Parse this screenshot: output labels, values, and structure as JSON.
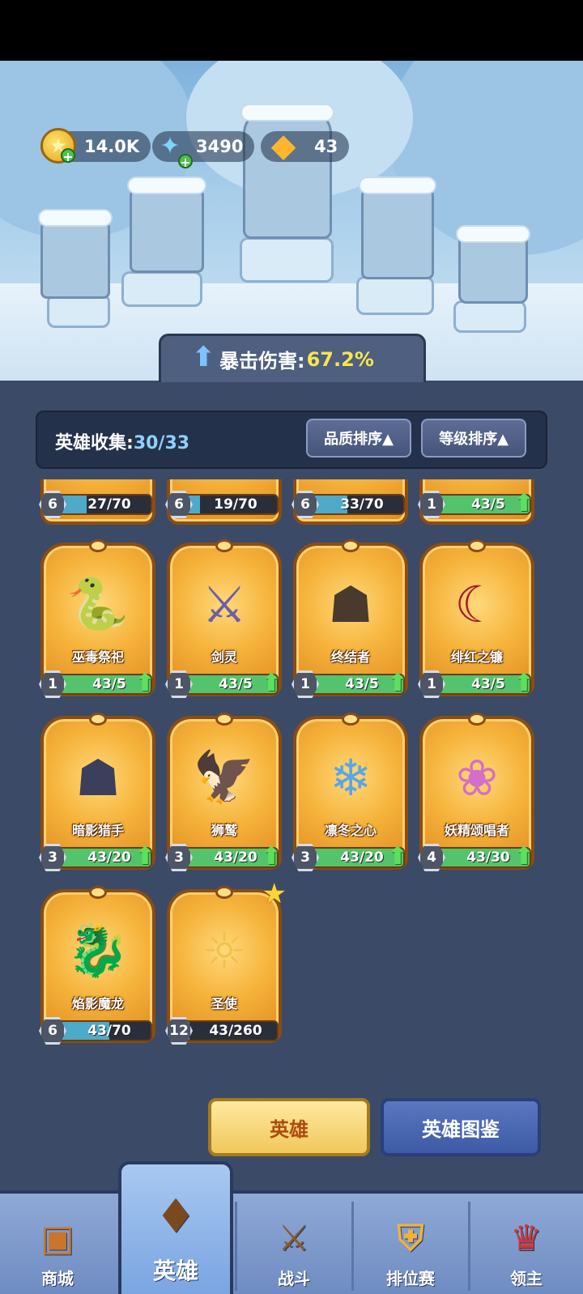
{
  "resources": [
    {
      "name": "gold",
      "icon": "gold-coin-icon",
      "value": "14.0K"
    },
    {
      "name": "crystal",
      "icon": "blue-crystal-icon",
      "value": "3490"
    },
    {
      "name": "gem",
      "icon": "orange-crystal-icon",
      "value": "43"
    }
  ],
  "buff": {
    "label": "暴击伤害:",
    "value": "67.2%"
  },
  "collection": {
    "label": "英雄收集:",
    "count": "30/33",
    "sort_quality": "品质排序▲",
    "sort_level": "等级排序▲"
  },
  "partial_cards": [
    {
      "level": "6",
      "progress": "27/70"
    },
    {
      "level": "6",
      "progress": "19/70"
    },
    {
      "level": "6",
      "progress": "33/70"
    },
    {
      "level": "1",
      "progress": "43/5"
    }
  ],
  "cards": [
    {
      "name": "巫毒祭祀",
      "level": "1",
      "progress": "43/5",
      "fill": 1.0,
      "upgrade": true
    },
    {
      "name": "剑灵",
      "level": "1",
      "progress": "43/5",
      "fill": 1.0,
      "upgrade": true
    },
    {
      "name": "终结者",
      "level": "1",
      "progress": "43/5",
      "fill": 1.0,
      "upgrade": true
    },
    {
      "name": "绯红之镰",
      "level": "1",
      "progress": "43/5",
      "fill": 1.0,
      "upgrade": true
    },
    {
      "name": "暗影猎手",
      "level": "3",
      "progress": "43/20",
      "fill": 1.0,
      "upgrade": true
    },
    {
      "name": "狮鹫",
      "level": "3",
      "progress": "43/20",
      "fill": 1.0,
      "upgrade": true
    },
    {
      "name": "凛冬之心",
      "level": "3",
      "progress": "43/20",
      "fill": 1.0,
      "upgrade": true
    },
    {
      "name": "妖精颂唱者",
      "level": "4",
      "progress": "43/30",
      "fill": 1.0,
      "upgrade": true
    },
    {
      "name": "焰影魔龙",
      "level": "6",
      "progress": "43/70",
      "fill": 0.61,
      "upgrade": false
    },
    {
      "name": "圣使",
      "level": "12",
      "progress": "43/260",
      "fill": 0.17,
      "upgrade": false
    }
  ],
  "buttons": {
    "hero": "英雄",
    "codex": "英雄图鉴"
  },
  "nav": [
    {
      "label": "商城",
      "icon": "shop-chest-icon"
    },
    {
      "label": "英雄",
      "icon": "hero-card-icon"
    },
    {
      "label": "战斗",
      "icon": "crossed-weapons-icon"
    },
    {
      "label": "排位赛",
      "icon": "rank-shield-icon"
    },
    {
      "label": "领主",
      "icon": "lord-banner-icon"
    }
  ]
}
